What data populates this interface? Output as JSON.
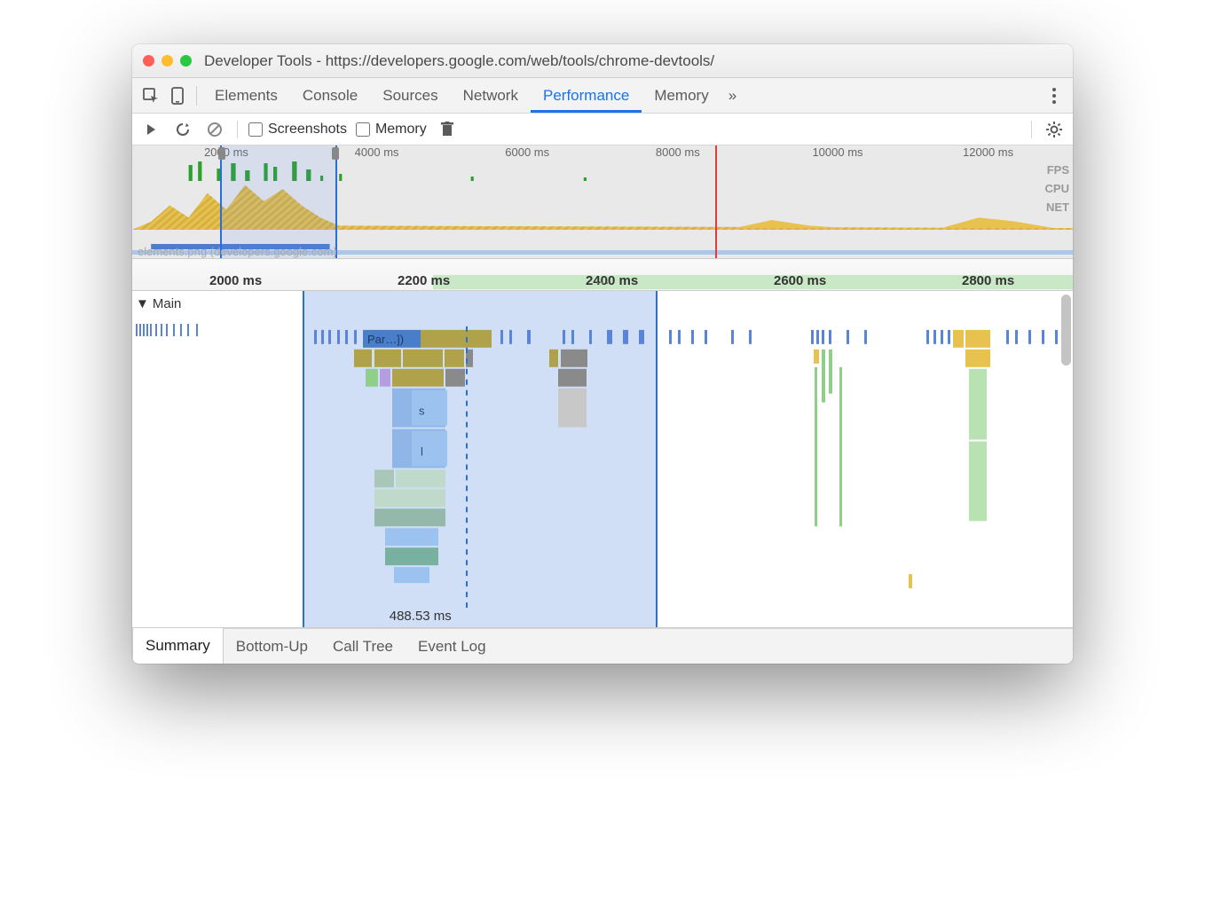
{
  "window": {
    "title": "Developer Tools - https://developers.google.com/web/tools/chrome-devtools/"
  },
  "tabs": {
    "items": [
      "Elements",
      "Console",
      "Sources",
      "Network",
      "Performance",
      "Memory"
    ],
    "active": "Performance",
    "overflow": "»"
  },
  "toolbar": {
    "screenshots_label": "Screenshots",
    "memory_label": "Memory"
  },
  "overview": {
    "ticks": [
      "2000 ms",
      "4000 ms",
      "6000 ms",
      "8000 ms",
      "10000 ms",
      "12000 ms"
    ],
    "lanes": [
      "FPS",
      "CPU",
      "NET"
    ],
    "network_label": "elements.png (developers.google.com)"
  },
  "ruler": {
    "ticks": [
      "2000 ms",
      "2200 ms",
      "2400 ms",
      "2600 ms",
      "2800 ms"
    ]
  },
  "flame": {
    "track_label": "Main",
    "parse_label": "Par…])",
    "s_label": "s",
    "l_label": "l",
    "measure_label": "488.53 ms"
  },
  "bottom_tabs": {
    "items": [
      "Summary",
      "Bottom-Up",
      "Call Tree",
      "Event Log"
    ],
    "active": "Summary"
  }
}
